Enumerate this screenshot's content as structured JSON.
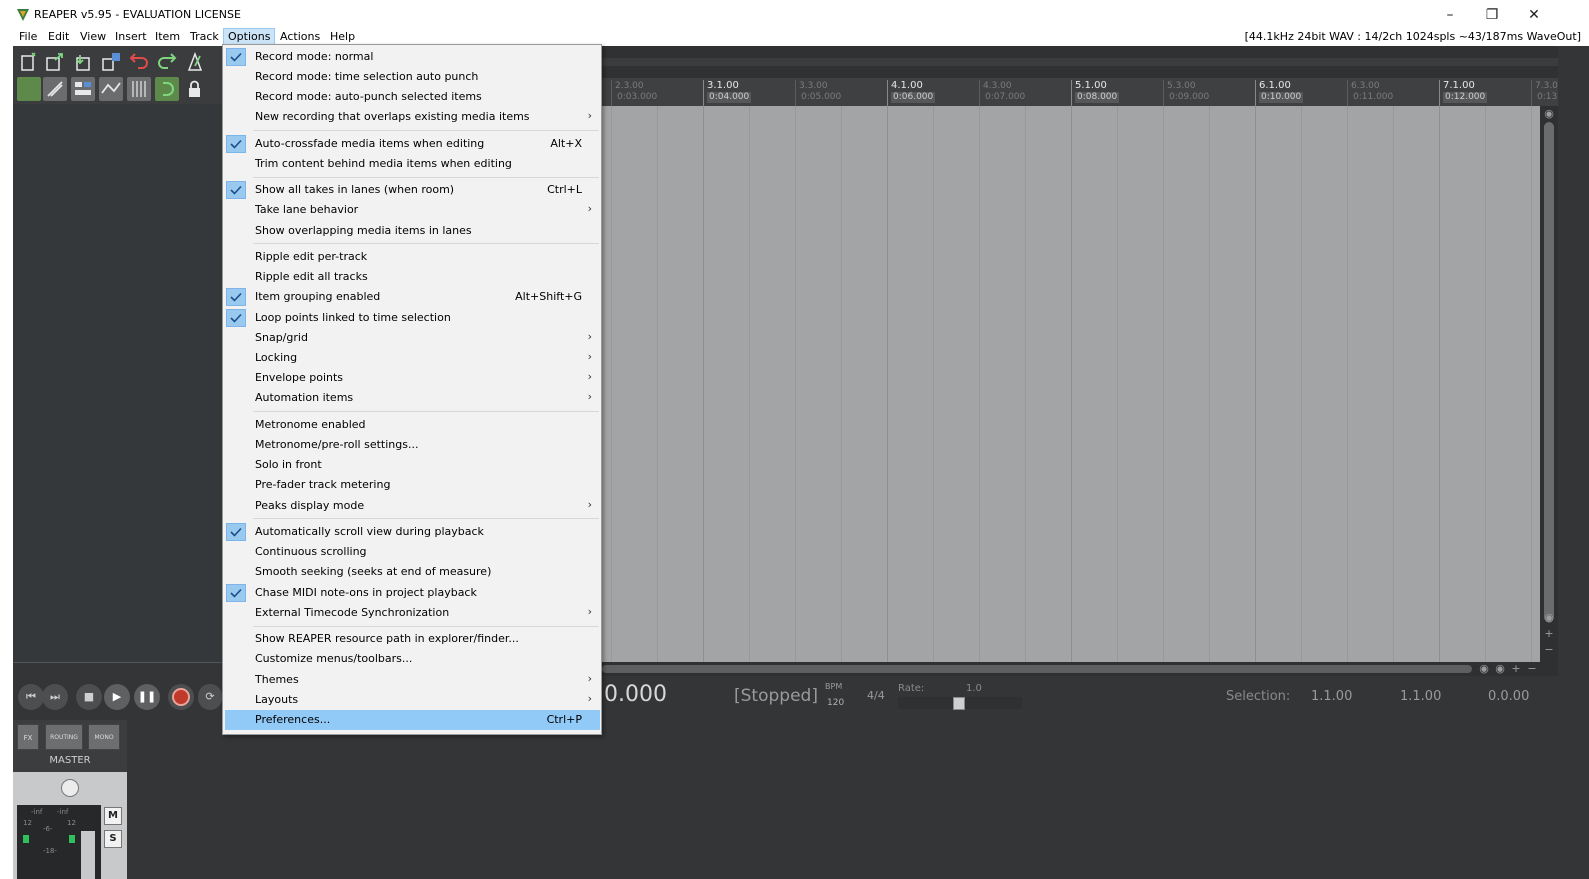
{
  "window": {
    "title": "REAPER v5.95 - EVALUATION LICENSE",
    "minimize_glyph": "–",
    "restore_glyph": "❐",
    "close_glyph": "✕"
  },
  "menubar": {
    "items": [
      "File",
      "Edit",
      "View",
      "Insert",
      "Item",
      "Track",
      "Options",
      "Actions",
      "Help"
    ],
    "active": "Options",
    "audio_status": "[44.1kHz 24bit WAV : 14/2ch 1024spls ~43/187ms WaveOut]"
  },
  "ruler": {
    "marks": [
      {
        "bar": "2.3.00",
        "time": "0:03.000",
        "minor": true
      },
      {
        "bar": "3.1.00",
        "time": "0:04.000",
        "minor": false
      },
      {
        "bar": "3.3.00",
        "time": "0:05.000",
        "minor": true
      },
      {
        "bar": "4.1.00",
        "time": "0:06.000",
        "minor": false
      },
      {
        "bar": "4.3.00",
        "time": "0:07.000",
        "minor": true
      },
      {
        "bar": "5.1.00",
        "time": "0:08.000",
        "minor": false
      },
      {
        "bar": "5.3.00",
        "time": "0:09.000",
        "minor": true
      },
      {
        "bar": "6.1.00",
        "time": "0:10.000",
        "minor": false
      },
      {
        "bar": "6.3.00",
        "time": "0:11.000",
        "minor": true
      },
      {
        "bar": "7.1.00",
        "time": "0:12.000",
        "minor": false
      },
      {
        "bar": "7.3.0",
        "time": "0:13",
        "minor": true
      }
    ]
  },
  "transport": {
    "time": "0.000",
    "state": "[Stopped]",
    "bpm_label": "BPM",
    "bpm": "120",
    "time_signature": "4/4",
    "rate_label": "Rate:",
    "rate_value": "1.0",
    "selection_label": "Selection:",
    "selection_start": "1.1.00",
    "selection_end": "1.1.00",
    "selection_length": "0.0.00"
  },
  "mixer": {
    "master_label": "MASTER",
    "fx_label": "FX",
    "routing_label": "ROUTING",
    "mono_label": "MONO",
    "mute_label": "M",
    "solo_label": "S",
    "meter_left": "-inf",
    "meter_right": "-inf",
    "scale": [
      "12",
      "-6-",
      "12",
      "-18-"
    ]
  },
  "options_menu": {
    "groups": [
      [
        {
          "label": "Record mode: normal",
          "checked": true
        },
        {
          "label": "Record mode: time selection auto punch"
        },
        {
          "label": "Record mode: auto-punch selected items"
        },
        {
          "label": "New recording that overlaps existing media items",
          "submenu": true
        }
      ],
      [
        {
          "label": "Auto-crossfade media items when editing",
          "checked": true,
          "shortcut": "Alt+X"
        },
        {
          "label": "Trim content behind media items when editing"
        }
      ],
      [
        {
          "label": "Show all takes in lanes (when room)",
          "checked": true,
          "shortcut": "Ctrl+L"
        },
        {
          "label": "Take lane behavior",
          "submenu": true
        },
        {
          "label": "Show overlapping media items in lanes"
        }
      ],
      [
        {
          "label": "Ripple edit per-track"
        },
        {
          "label": "Ripple edit all tracks"
        },
        {
          "label": "Item grouping enabled",
          "checked": true,
          "shortcut": "Alt+Shift+G"
        },
        {
          "label": "Loop points linked to time selection",
          "checked": true
        },
        {
          "label": "Snap/grid",
          "submenu": true
        },
        {
          "label": "Locking",
          "submenu": true
        },
        {
          "label": "Envelope points",
          "submenu": true
        },
        {
          "label": "Automation items",
          "submenu": true
        }
      ],
      [
        {
          "label": "Metronome enabled"
        },
        {
          "label": "Metronome/pre-roll settings..."
        },
        {
          "label": "Solo in front"
        },
        {
          "label": "Pre-fader track metering"
        },
        {
          "label": "Peaks display mode",
          "submenu": true
        }
      ],
      [
        {
          "label": "Automatically scroll view during playback",
          "checked": true
        },
        {
          "label": "Continuous scrolling"
        },
        {
          "label": "Smooth seeking (seeks at end of measure)"
        },
        {
          "label": "Chase MIDI note-ons in project playback",
          "checked": true
        },
        {
          "label": "External Timecode Synchronization",
          "submenu": true
        }
      ],
      [
        {
          "label": "Show REAPER resource path in explorer/finder..."
        },
        {
          "label": "Customize menus/toolbars..."
        },
        {
          "label": "Themes",
          "submenu": true
        },
        {
          "label": "Layouts",
          "submenu": true
        },
        {
          "label": "Preferences...",
          "shortcut": "Ctrl+P",
          "highlighted": true
        }
      ]
    ]
  },
  "colors": {
    "menu_highlight": "#91c9f7",
    "check_background": "#99c9ef",
    "arrange_background": "#a3a4a5",
    "app_background": "#333537"
  }
}
